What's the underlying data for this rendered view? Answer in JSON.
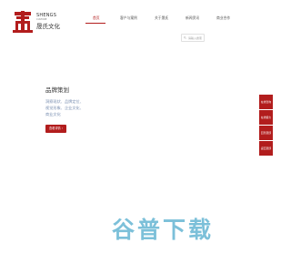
{
  "brand": {
    "name_en": "SHENGS",
    "name_en_sub": "CULTURE",
    "name_cn": "晟氏文化",
    "color": "#b21d1d"
  },
  "nav": {
    "items": [
      {
        "label": "首页",
        "active": true
      },
      {
        "label": "客户与案例"
      },
      {
        "label": "关于晟氏"
      },
      {
        "label": "新闻资讯"
      },
      {
        "label": "商业合作"
      }
    ]
  },
  "search": {
    "placeholder": "请输入搜索"
  },
  "hero": {
    "title": "品牌策划",
    "desc_lines": [
      "洞察现状、品牌定位、",
      "视觉形象、企业文化、",
      "商业文化"
    ],
    "button_label": "查看详情 ›"
  },
  "sidebar": {
    "items": [
      "在线咨询",
      "在线留言",
      "回到顶部",
      "返回顶部"
    ]
  },
  "watermark": {
    "text": "谷普下载",
    "color": "#7cc0d9"
  }
}
